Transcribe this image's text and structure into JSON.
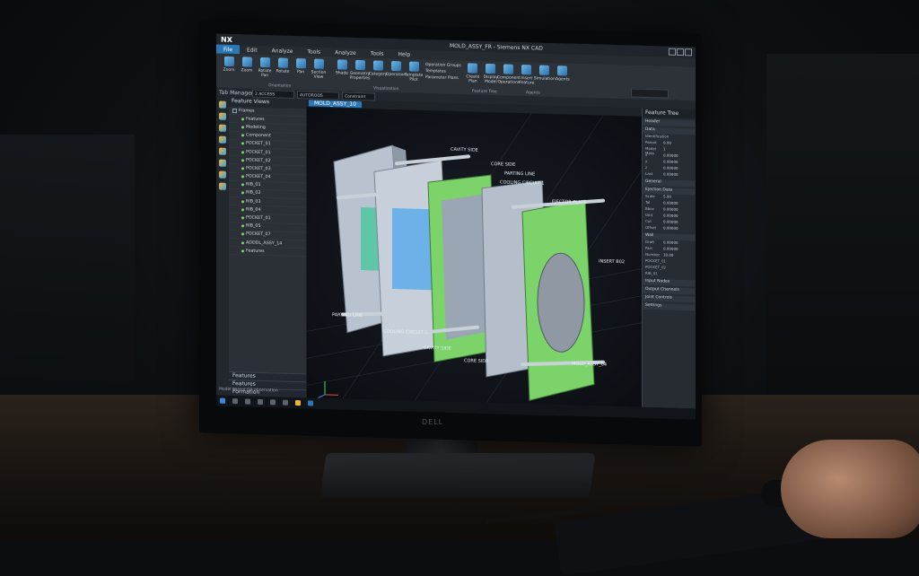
{
  "app": {
    "logo": "NX",
    "window_title": "MOLD_ASSY_FR - Siemens NX CAD"
  },
  "menu": [
    "File",
    "Edit",
    "Analyze",
    "Tools",
    "Analyze",
    "Tools",
    "Help"
  ],
  "ribbon": {
    "buttons": [
      "Zoom",
      "Zoom",
      "Rotate Pan",
      "Rotate",
      "Pan",
      "Section View",
      "Shade",
      "Geometry Properties",
      "Category",
      "Operation",
      "Template Pilot"
    ],
    "small_buttons": [
      "Operation Groups",
      "Templates",
      "Parameter Plans"
    ],
    "buttons2": [
      "Create Plan",
      "Display Model",
      "Component Operations",
      "Insert Feature"
    ],
    "buttons3": [
      "Simulation",
      "Agents"
    ],
    "groups": [
      "Orientation",
      "Visualization",
      "Feature Tree",
      "Agents"
    ]
  },
  "filterbar": {
    "label": "Tab Manager:",
    "combo1": "2 ACCESS",
    "combo2": "AUTOROOS",
    "combo3": "Constraint"
  },
  "tab": "MOLD_ASSY_10",
  "tree": {
    "header": "Feature Views",
    "root": "Frames",
    "items": [
      "Features",
      "Modeling",
      "Component",
      "POCKET_01",
      "POCKET_01",
      "POCKET_02",
      "POCKET_03",
      "POCKET_04",
      "RIB_01",
      "RIB_02",
      "RIB_03",
      "RIB_04",
      "POCKET_01",
      "RIB_05",
      "POCKET_07",
      "ADDDL_ASSY_14",
      "Features"
    ],
    "accordions": [
      "Features",
      "Features",
      "Formation"
    ]
  },
  "viewport_labels": [
    "CAVITY SIDE",
    "CORE SIDE",
    "PARTING LINE",
    "COOLING CIRCUIT 1",
    "EJECTOR PLATE",
    "INSERT B02",
    "PARTING LINE",
    "COOLING CIRCUIT 1",
    "CAVITY SIDE",
    "CORE SIDE",
    "MOLD_ASSY_04"
  ],
  "props": {
    "header": "Feature Tree",
    "sections": [
      "Header",
      "Data",
      "General",
      "Ejection Data",
      "Wall",
      "Input Nodes",
      "Output Channels",
      "Joint Controls",
      "Settings"
    ],
    "rows": [
      [
        "Identification",
        ""
      ],
      [
        "Parent",
        "0.00"
      ],
      [
        "Model Mass",
        "1"
      ],
      [
        "x",
        "0.00000"
      ],
      [
        "y",
        "0.00000"
      ],
      [
        "z",
        "0.00000"
      ],
      [
        "Last",
        "0.00000"
      ],
      [
        "Scale",
        "5.00"
      ],
      [
        "Tol",
        "0.00000"
      ],
      [
        "Bbox",
        "0.00000"
      ],
      [
        "Unit",
        "0.00000"
      ],
      [
        "Cut",
        "0.00000"
      ],
      [
        "Offset",
        "0.00000"
      ],
      [
        "Draft",
        "0.00000"
      ],
      [
        "Part",
        "0.00000"
      ],
      [
        "Number",
        "10.00"
      ],
      [
        "POCKET_01",
        ""
      ],
      [
        "POCKET_02",
        ""
      ],
      [
        "RIB_01",
        ""
      ]
    ]
  },
  "status_text": "Model parent Git observation",
  "colors": {
    "accent": "#2a78b8",
    "plate_green": "#7bd36a",
    "plate_grey": "#a9b4c2",
    "cooling": "#2f9cf0"
  }
}
